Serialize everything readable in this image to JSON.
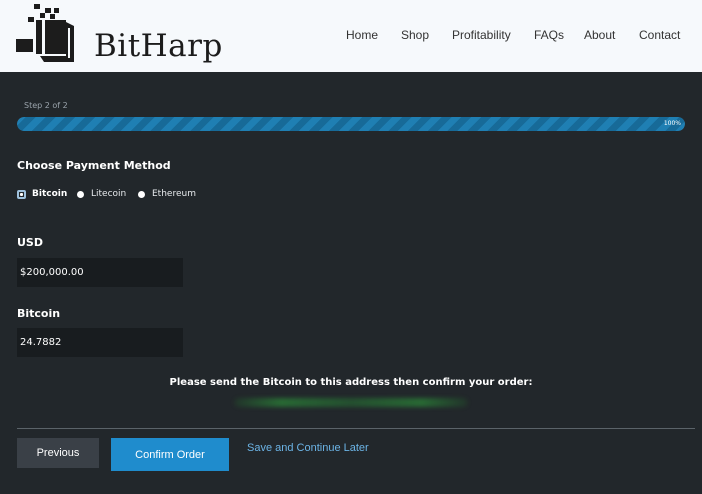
{
  "header": {
    "logo_text": "BitHarp",
    "nav": [
      "Home",
      "Shop",
      "Profitability",
      "FAQs",
      "About",
      "Contact"
    ]
  },
  "progress": {
    "step_label": "Step 2 of 2",
    "percent_label": "100%",
    "fraction": 1.0
  },
  "payment": {
    "title": "Choose Payment Method",
    "options": [
      "Bitcoin",
      "Litecoin",
      "Ethereum"
    ],
    "selected": "Bitcoin"
  },
  "usd": {
    "label": "USD",
    "value": "$200,000.00"
  },
  "bitcoin": {
    "label": "Bitcoin",
    "value": "24.7882"
  },
  "message": "Please send the Bitcoin to this address then confirm your order:",
  "buttons": {
    "previous": "Previous",
    "confirm": "Confirm Order",
    "save_later": "Save and Continue Later"
  },
  "colors": {
    "accent": "#1f8ccd",
    "background": "#22272b",
    "header": "#f6f9fc"
  }
}
